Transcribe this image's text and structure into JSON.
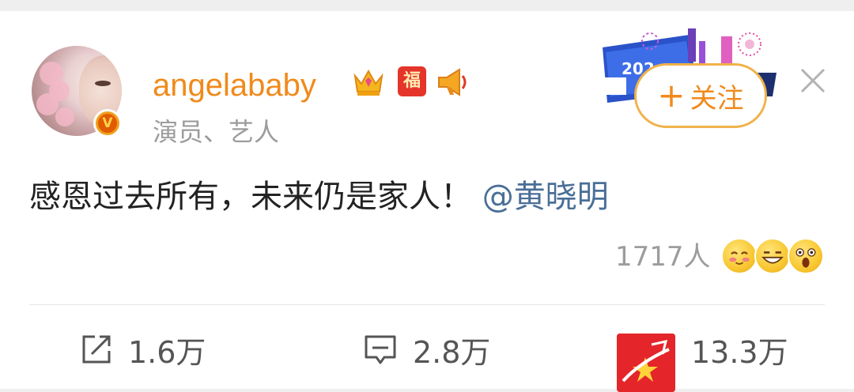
{
  "user": {
    "name": "angelababy",
    "bio": "演员、艺人",
    "verified_badge": "V",
    "fu_badge": "福"
  },
  "header": {
    "follow_label": "关注",
    "follow_plus": "+"
  },
  "post": {
    "text": "感恩过去所有，未来仍是家人！",
    "mention": "@黄晓明"
  },
  "reactions": {
    "count": "1717人",
    "emojis": [
      "blush-emoji-icon",
      "grin-emoji-icon",
      "surprised-emoji-icon"
    ]
  },
  "actions": {
    "repost": "1.6万",
    "comment": "2.8万",
    "like": "13.3万"
  },
  "colors": {
    "name": "#f08a1c",
    "mention": "#4a6f97",
    "watermark": "#e4262a"
  }
}
